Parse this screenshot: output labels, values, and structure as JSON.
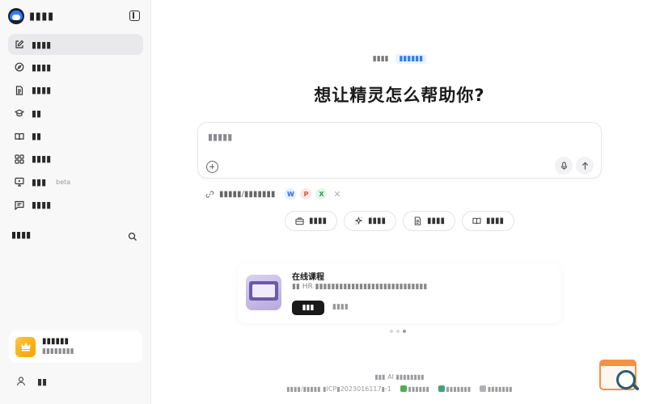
{
  "sidebar": {
    "brand_name": "▮▮▮▮",
    "items": [
      {
        "label": "▮▮▮▮",
        "icon": "edit-icon"
      },
      {
        "label": "▮▮▮▮",
        "icon": "compass-icon"
      },
      {
        "label": "▮▮▮▮",
        "icon": "document-icon"
      },
      {
        "label": "▮▮",
        "icon": "graduation-cap-icon"
      },
      {
        "label": "▮▮",
        "icon": "book-icon"
      },
      {
        "label": "▮▮▮▮",
        "icon": "apps-grid-icon"
      },
      {
        "label": "▮▮▮",
        "icon": "presentation-icon",
        "badge": "beta"
      },
      {
        "label": "▮▮▮▮",
        "icon": "message-icon"
      }
    ],
    "history_label": "▮▮▮▮",
    "vip": {
      "title": "▮▮▮▮▮▮",
      "subtitle": "▮▮▮▮▮▮▮▮"
    },
    "user_name": "▮▮"
  },
  "main": {
    "tagline_a": "▮▮▮▮",
    "tagline_b": "▮▮▮▮▮▮",
    "headline": "想让精灵怎么帮助你?",
    "input_placeholder": "▮▮▮▮▮",
    "links_label": "▮▮▮▮▮/▮▮▮▮▮▮▮",
    "file_types": [
      "W",
      "P",
      "X"
    ],
    "quick_actions": [
      {
        "label": "▮▮▮▮",
        "icon": "briefcase-icon"
      },
      {
        "label": "▮▮▮▮",
        "icon": "sparkle-icon"
      },
      {
        "label": "▮▮▮▮",
        "icon": "document-icon"
      },
      {
        "label": "▮▮▮▮",
        "icon": "book-icon"
      }
    ],
    "course": {
      "title": "在线课程",
      "description": "▮▮ HR ▮▮▮▮▮▮▮▮▮▮▮▮▮▮▮▮▮▮▮▮▮▮▮▮▮▮▮▮",
      "button_label": "▮▮▮",
      "more_label": "▮▮▮▮"
    },
    "carousel_dots": 3,
    "carousel_active": 3,
    "footer_line1": "▮▮▮ AI ▮▮▮▮▮▮▮▮",
    "footer_icp": "▮▮▮▮/▮▮▮▮▮ ▮ICP▮2023016117▮-1",
    "footer_items": [
      "▮▮▮▮▮▮",
      "▮▮▮▮▮▮▮",
      "▮▮▮▮▮▮▮"
    ]
  },
  "colors": {
    "accent": "#2f7df6",
    "vip": "#f5a300",
    "widget": "#f0924a"
  }
}
